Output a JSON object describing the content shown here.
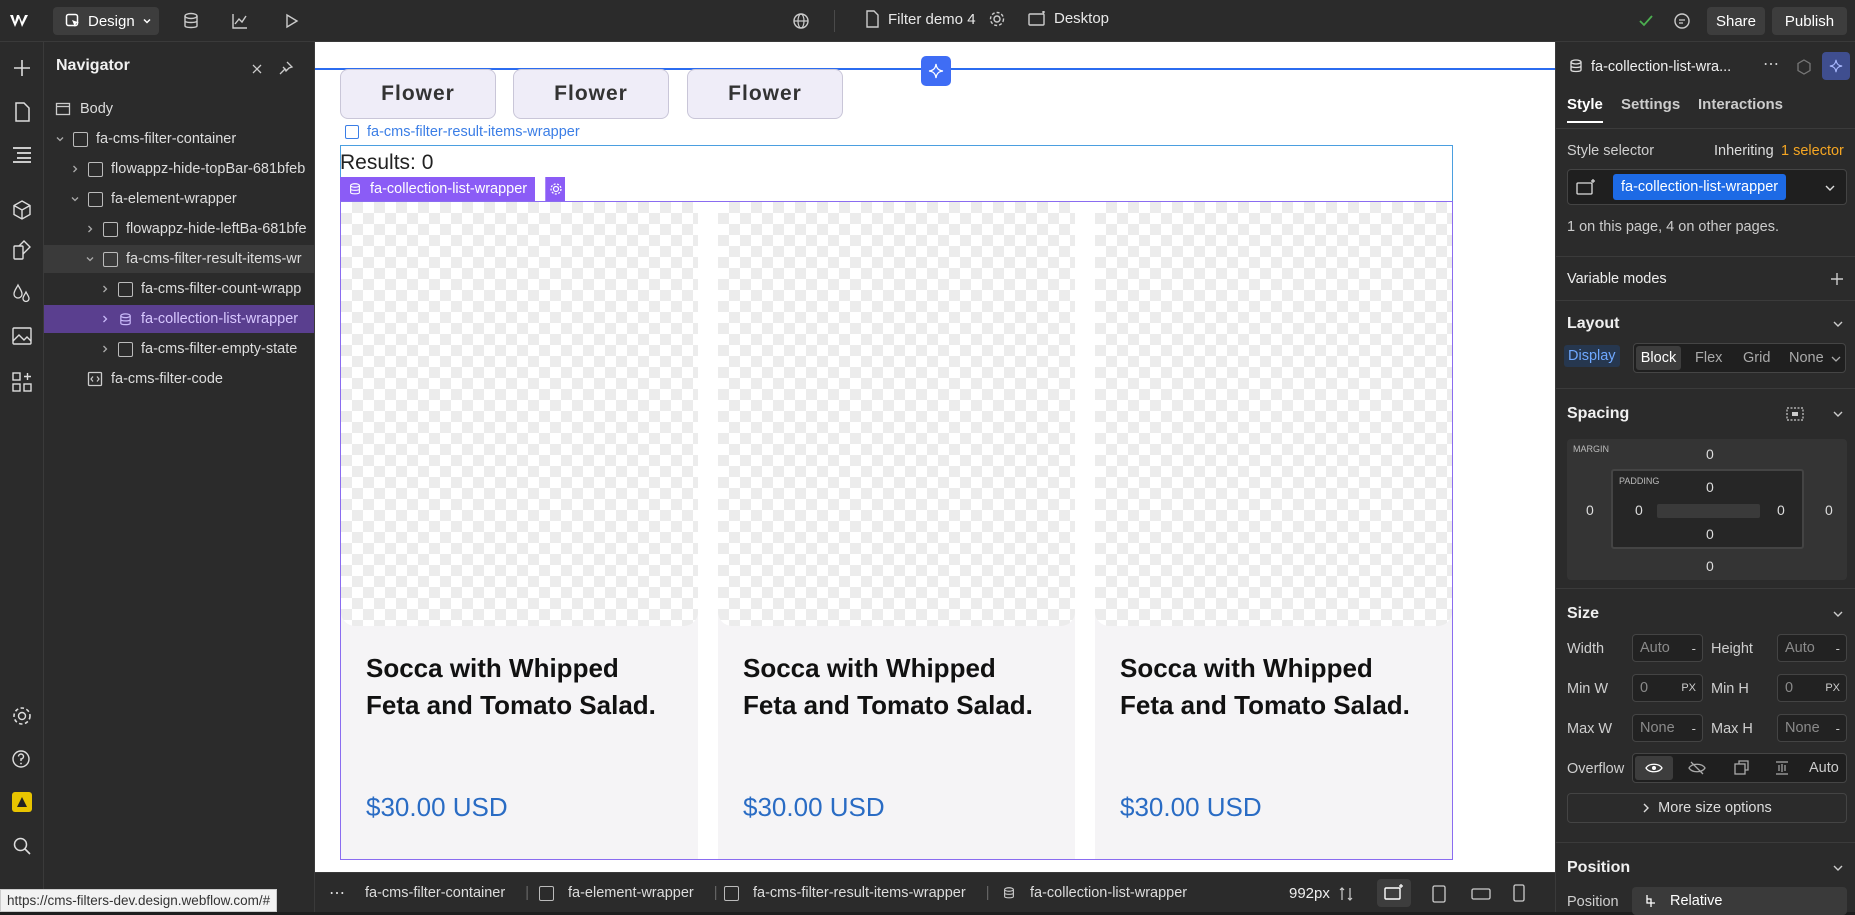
{
  "topbar": {
    "mode_label": "Design",
    "page_name": "Filter demo 4",
    "breakpoint_label": "Desktop",
    "share_label": "Share",
    "publish_label": "Publish"
  },
  "navigator": {
    "title": "Navigator",
    "items": [
      {
        "label": "Body"
      },
      {
        "label": "fa-cms-filter-container"
      },
      {
        "label": "flowappz-hide-topBar-681bfeb"
      },
      {
        "label": "fa-element-wrapper"
      },
      {
        "label": "flowappz-hide-leftBa-681bfe"
      },
      {
        "label": "fa-cms-filter-result-items-wr"
      },
      {
        "label": "fa-cms-filter-count-wrapp"
      },
      {
        "label": "fa-collection-list-wrapper"
      },
      {
        "label": "fa-cms-filter-empty-state"
      },
      {
        "label": "fa-cms-filter-code"
      }
    ]
  },
  "canvas": {
    "tags": [
      "Flower",
      "Flower",
      "Flower"
    ],
    "result_wrapper_label": "fa-cms-filter-result-items-wrapper",
    "results_text": "Results: 0",
    "collection_label": "fa-collection-list-wrapper",
    "cards": [
      {
        "title": "Socca with Whipped Feta and Tomato Salad.",
        "price": "$30.00 USD"
      },
      {
        "title": "Socca with Whipped Feta and Tomato Salad.",
        "price": "$30.00 USD"
      },
      {
        "title": "Socca with Whipped Feta and Tomato Salad.",
        "price": "$30.00 USD"
      }
    ]
  },
  "bottombar": {
    "crumbs": [
      "fa-cms-filter-container",
      "fa-element-wrapper",
      "fa-cms-filter-result-items-wrapper",
      "fa-collection-list-wrapper"
    ],
    "width_readout": "992px"
  },
  "status_url": "https://cms-filters-dev.design.webflow.com/#",
  "panel": {
    "element_name": "fa-collection-list-wra...",
    "tabs": [
      "Style",
      "Settings",
      "Interactions"
    ],
    "style_selector_label": "Style selector",
    "inheriting_text": "Inheriting",
    "inheriting_count": "1 selector",
    "selector_chip": "fa-collection-list-wrapper",
    "usage_text": "1 on this page, 4 on other pages.",
    "variable_modes": "Variable modes",
    "layout": {
      "title": "Layout",
      "display_label": "Display",
      "options": [
        "Block",
        "Flex",
        "Grid",
        "None"
      ]
    },
    "spacing": {
      "title": "Spacing",
      "margin_label": "MARGIN",
      "padding_label": "PADDING",
      "margin": {
        "top": "0",
        "right": "0",
        "bottom": "0",
        "left": "0"
      },
      "padding": {
        "top": "0",
        "right": "0",
        "bottom": "0",
        "left": "0"
      }
    },
    "size": {
      "title": "Size",
      "width_label": "Width",
      "width_value": "Auto",
      "height_label": "Height",
      "height_value": "Auto",
      "minw_label": "Min W",
      "minw_value": "0",
      "minw_unit": "PX",
      "minh_label": "Min H",
      "minh_value": "0",
      "minh_unit": "PX",
      "maxw_label": "Max W",
      "maxw_value": "None",
      "maxh_label": "Max H",
      "maxh_value": "None",
      "overflow_label": "Overflow",
      "overflow_auto": "Auto",
      "more_label": "More size options",
      "dash": "-"
    },
    "position": {
      "title": "Position",
      "label": "Position",
      "value": "Relative"
    }
  },
  "colors": {
    "accent": "#3f6df5",
    "selection_purple": "#8b5cf6",
    "price_blue": "#2a6cc4"
  }
}
